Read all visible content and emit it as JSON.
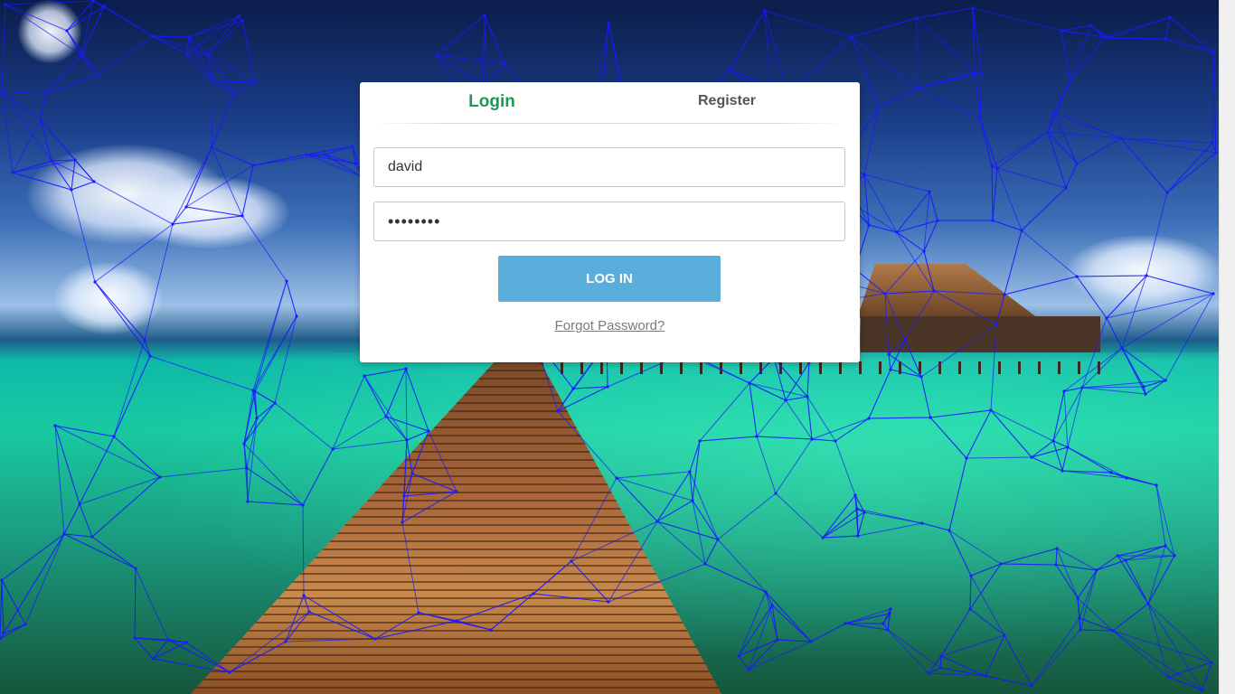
{
  "tabs": {
    "login_label": "Login",
    "register_label": "Register"
  },
  "form": {
    "username_value": "david",
    "password_value": "secret01",
    "login_button_label": "LOG IN",
    "forgot_password_label": "Forgot Password?"
  },
  "colors": {
    "active_tab": "#1a9a54",
    "inactive_tab": "#555555",
    "login_button": "#5aaedb",
    "mesh_lines": "#1a1aff"
  },
  "background": {
    "description_icon": "tropical-boardwalk-background"
  }
}
